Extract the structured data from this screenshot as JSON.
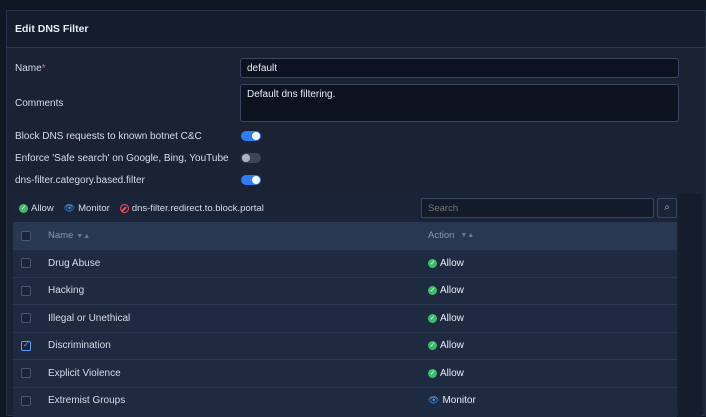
{
  "title": "Edit DNS Filter",
  "name": {
    "label": "Name",
    "required_mark": "*",
    "value": "default"
  },
  "comments": {
    "label": "Comments",
    "value": "Default dns filtering."
  },
  "toggles": [
    {
      "label": "Block DNS requests to known botnet C&C",
      "state": "on"
    },
    {
      "label": "Enforce 'Safe search' on Google, Bing, YouTube",
      "state": "off"
    },
    {
      "label": "dns-filter.category.based.filter",
      "state": "on"
    }
  ],
  "legend": {
    "allow": "Allow",
    "monitor": "Monitor",
    "block": "dns-filter.redirect.to.block.portal"
  },
  "search": {
    "placeholder": "Search"
  },
  "table": {
    "headers": {
      "name": "Name",
      "action": "Action"
    },
    "rows": [
      {
        "name": "Drug Abuse",
        "action": "Allow",
        "checked": false
      },
      {
        "name": "Hacking",
        "action": "Allow",
        "checked": false
      },
      {
        "name": "Illegal or Unethical",
        "action": "Allow",
        "checked": false
      },
      {
        "name": "Discrimination",
        "action": "Allow",
        "checked": true
      },
      {
        "name": "Explicit Violence",
        "action": "Allow",
        "checked": false
      },
      {
        "name": "Extremist Groups",
        "action": "Monitor",
        "checked": false
      }
    ]
  },
  "colors": {
    "accent": "#2f7cf6",
    "allow": "#3dbd6a",
    "monitor": "#3aa0ff",
    "block": "#ff4a5a"
  }
}
